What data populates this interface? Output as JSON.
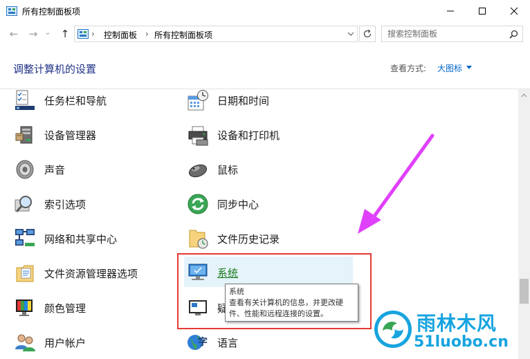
{
  "window": {
    "title": "所有控制面板项",
    "minimize_icon": "minimize-icon",
    "maximize_icon": "maximize-icon",
    "close_icon": "close-icon"
  },
  "nav": {
    "back": "←",
    "forward": "→",
    "dropdown": "⌄",
    "up": "↑"
  },
  "address": {
    "crumb_sep": "›",
    "crumbs": [
      "控制面板",
      "所有控制面板项"
    ]
  },
  "search": {
    "placeholder": "搜索控制面板"
  },
  "header": {
    "title": "调整计算机的设置",
    "view_label": "查看方式:",
    "view_value": "大图标"
  },
  "items_left": [
    {
      "label": "任务栏和导航",
      "icon": "taskbar-icon"
    },
    {
      "label": "设备管理器",
      "icon": "device-manager-icon"
    },
    {
      "label": "声音",
      "icon": "speaker-icon"
    },
    {
      "label": "索引选项",
      "icon": "indexing-icon"
    },
    {
      "label": "网络和共享中心",
      "icon": "network-icon"
    },
    {
      "label": "文件资源管理器选项",
      "icon": "folder-options-icon"
    },
    {
      "label": "颜色管理",
      "icon": "color-management-icon"
    },
    {
      "label": "用户帐户",
      "icon": "user-accounts-icon"
    }
  ],
  "items_right": [
    {
      "label": "日期和时间",
      "icon": "calendar-clock-icon"
    },
    {
      "label": "设备和打印机",
      "icon": "printer-icon"
    },
    {
      "label": "鼠标",
      "icon": "mouse-icon"
    },
    {
      "label": "同步中心",
      "icon": "sync-icon"
    },
    {
      "label": "文件历史记录",
      "icon": "file-history-icon"
    },
    {
      "label": "系统",
      "icon": "monitor-icon"
    },
    {
      "label": "疑",
      "icon": "troubleshoot-icon"
    },
    {
      "label": "语言",
      "icon": "language-icon"
    }
  ],
  "tooltip": {
    "title": "系统",
    "line1": "查看有关计算机的信息，并更改硬",
    "line2": "件、性能和远程连接的设置。"
  },
  "watermark": {
    "brand": "雨林木风",
    "url": "51luobo.cn"
  },
  "colors": {
    "accent_title": "#1e3287",
    "link": "#0066cc",
    "highlight": "#e5f3fb",
    "red_box": "#e53935",
    "arrow": "#e040fb"
  }
}
